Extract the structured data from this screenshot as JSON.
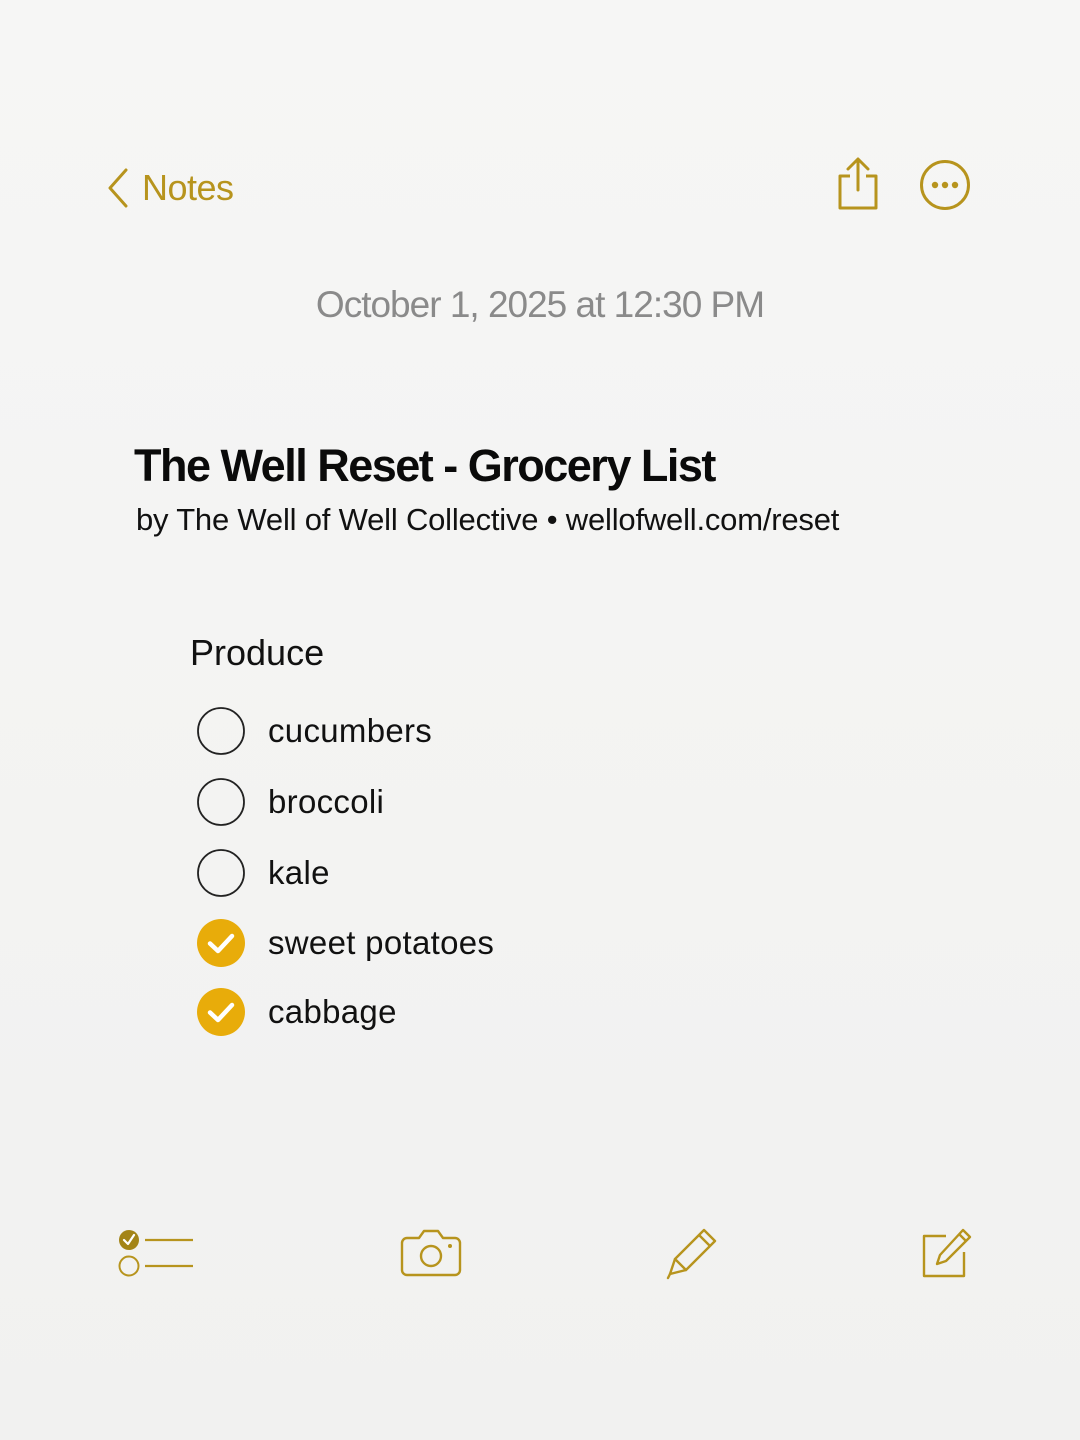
{
  "nav": {
    "back_label": "Notes",
    "share_icon": "share-icon",
    "more_icon": "more-ellipsis-icon"
  },
  "note": {
    "timestamp": "October 1, 2025 at 12:30 PM",
    "title": "The Well Reset - Grocery List",
    "byline": "by The Well of Well Collective • wellofwell.com/reset",
    "section": "Produce",
    "items": [
      {
        "label": "cucumbers",
        "checked": false
      },
      {
        "label": "broccoli",
        "checked": false
      },
      {
        "label": "kale",
        "checked": false
      },
      {
        "label": "sweet potatoes",
        "checked": true
      },
      {
        "label": "cabbage",
        "checked": true
      }
    ]
  },
  "toolbar": {
    "icons": [
      "checklist-icon",
      "camera-icon",
      "markup-pen-icon",
      "compose-icon"
    ]
  },
  "colors": {
    "accent": "#b7941d",
    "checked_fill": "#e8ac0a",
    "timestamp_gray": "#8a8a8a",
    "background": "#f4f4f3"
  }
}
